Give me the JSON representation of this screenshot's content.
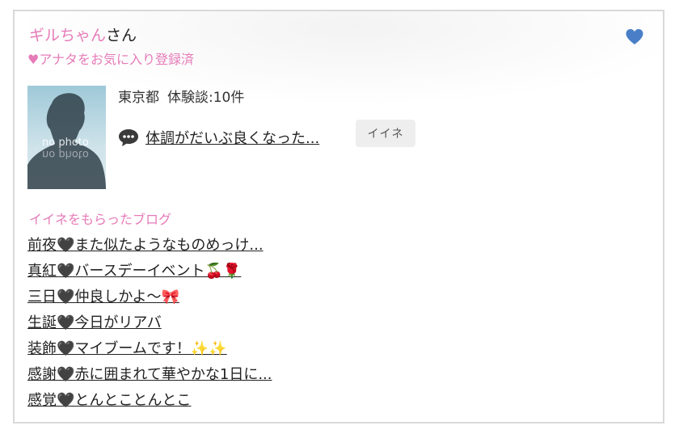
{
  "user": {
    "name": "ギルちゃん",
    "suffix": "さん",
    "favorite_status": "♥アナタをお気に入り登録済",
    "photo_placeholder": "no photo",
    "location": "東京都",
    "experience_count": "体験談:10件",
    "latest_comment": "体調がだいぶ良くなった...",
    "iine_label": "イイネ"
  },
  "icons": {
    "favorite": "heart-icon",
    "comment": "speech-bubble-icon"
  },
  "colors": {
    "accent_pink": "#e67bb8",
    "heart_blue": "#4a7fc8"
  },
  "blogs": {
    "heading": "イイネをもらったブログ",
    "items": [
      "前夜🖤また似たようなものめっけ...",
      "真紅🖤バースデーイベント🍒🌹",
      "三日🖤仲良しかよ〜🎀",
      "生誕🖤今日がリアバ",
      "装飾🖤マイブームです！✨✨",
      "感謝🖤赤に囲まれて華やかな1日に...",
      "感覚🖤とんとことんとこ"
    ]
  }
}
